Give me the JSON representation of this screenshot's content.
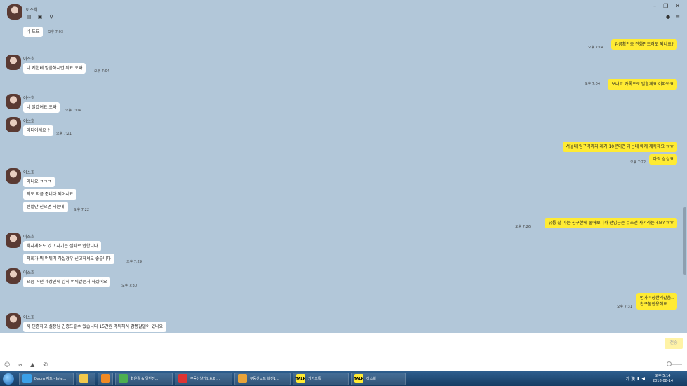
{
  "header": {
    "contact_name": "이소희",
    "left_icons": [
      "list-icon",
      "drawer-icon",
      "search-icon"
    ],
    "right_icons": [
      "bell-icon",
      "menu-icon"
    ],
    "window_controls": [
      "minimize-icon",
      "restore-icon",
      "close-icon"
    ]
  },
  "messages": [
    {
      "side": "left",
      "sender": "",
      "text": "네 도요",
      "time": "오후 7:03"
    },
    {
      "side": "right",
      "text": "입금확인증 전화안드려도 되나요?",
      "time": "오후 7:04"
    },
    {
      "side": "left",
      "sender": "이소희",
      "text": "네 저한테 말씀하시면 되요 오빠",
      "time": "오후 7:04"
    },
    {
      "side": "right",
      "text": "보내고 카톡으로 말할게요 이따봐요",
      "time": "오후 7:04"
    },
    {
      "side": "left",
      "sender": "이소희",
      "text": "네 알겠어요 오빠",
      "time": "오후 7:04"
    },
    {
      "side": "left",
      "sender": "이소희",
      "text": "어디이세요 ?",
      "time": "오후 7:21"
    },
    {
      "side": "right",
      "text": "서울대 입구역까지 제가 10분이면 가는데 왜케 재촉해요 ㅠㅠ",
      "time": ""
    },
    {
      "side": "right",
      "text": "아직 삼실요",
      "time": "오후 7:22"
    },
    {
      "side": "left",
      "sender": "이소희",
      "text": "아니요 ㅋㅋㅋ",
      "time": ""
    },
    {
      "side": "left",
      "sender": "",
      "text": "저도 지금 준비다 되어서요",
      "time": ""
    },
    {
      "side": "left",
      "sender": "",
      "text": "신발만 신으면 되는데",
      "time": "오후 7:22"
    },
    {
      "side": "right",
      "text": "유통 잘 아는 친구한테 물어보니까 선입금은 무조건 사기라는데요? ㅠㅠ",
      "time": "오후 7:26"
    },
    {
      "side": "left",
      "sender": "이소희",
      "text": "회사계좌도 있고 사기는 절때로 안합니다",
      "time": ""
    },
    {
      "side": "left",
      "sender": "",
      "text": "저희가 뭐 먹튀기 하실경우 신고하셔도 좋습니다",
      "time": "오후 7:29"
    },
    {
      "side": "left",
      "sender": "이소희",
      "text": "요즘 어떤 세상인데 감히 먹튀같은거 하겠어요",
      "time": "오후 7:30"
    },
    {
      "side": "right",
      "text": "먼가이상한거같음..\n친구불한용해요",
      "time": "오후 7:31"
    },
    {
      "side": "left",
      "sender": "이소희",
      "text": "제 민증하고 실장님 민증드릴수 있습니다 15만원 먹튀해서 감빵갈일이 있나요",
      "time": ""
    }
  ],
  "input": {
    "send_label": "전송",
    "toolbar_icons": [
      "emoticon-icon",
      "attach-icon",
      "image-icon",
      "call-icon"
    ]
  },
  "taskbar": {
    "items": [
      {
        "label": "Daum 지도 - Inte...",
        "icon": "ie-icon",
        "color": "#3aa0e8"
      },
      {
        "label": "",
        "icon": "folder-icon",
        "color": "#f2c94c"
      },
      {
        "label": "",
        "icon": "media-player-icon",
        "color": "#f08a24"
      },
      {
        "label": "협은길 & 일반전...",
        "icon": "chrome-icon",
        "color": "#4caf50"
      },
      {
        "label": "부동산날개9.6.6 ...",
        "icon": "house-icon",
        "color": "#d33"
      },
      {
        "label": "부동산노트 버전1...",
        "icon": "note-icon",
        "color": "#e8a33a"
      },
      {
        "label": "카카오톡",
        "icon": "kakaotalk-icon",
        "color": "#ffeb33"
      },
      {
        "label": "이소희",
        "icon": "kakaotalk-icon",
        "color": "#ffeb33"
      }
    ],
    "tray": {
      "ime": "가 漢",
      "time": "오후 5:14",
      "date": "2018-08-14"
    }
  }
}
